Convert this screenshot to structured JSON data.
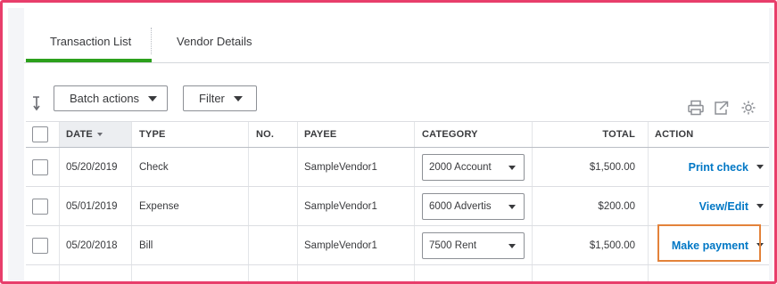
{
  "tabs": [
    {
      "label": "Transaction List",
      "active": true
    },
    {
      "label": "Vendor Details",
      "active": false
    }
  ],
  "toolbar": {
    "batch_actions_label": "Batch actions",
    "filter_label": "Filter"
  },
  "table": {
    "headers": {
      "date": "DATE",
      "type": "TYPE",
      "no": "NO.",
      "payee": "PAYEE",
      "category": "CATEGORY",
      "total": "TOTAL",
      "action": "ACTION"
    },
    "rows": [
      {
        "date": "05/20/2019",
        "type": "Check",
        "no": "",
        "payee": "SampleVendor1",
        "category": "2000 Account",
        "total": "$1,500.00",
        "action": "Print check"
      },
      {
        "date": "05/01/2019",
        "type": "Expense",
        "no": "",
        "payee": "SampleVendor1",
        "category": "6000 Advertis",
        "total": "$200.00",
        "action": "View/Edit"
      },
      {
        "date": "05/20/2018",
        "type": "Bill",
        "no": "",
        "payee": "SampleVendor1",
        "category": "7500 Rent",
        "total": "$1,500.00",
        "action": "Make payment"
      }
    ]
  },
  "colors": {
    "frame_border": "#e83e6b",
    "active_tab_underline": "#2ca01c",
    "link": "#0077c5",
    "highlight_box": "#e3823a"
  },
  "icons": [
    "sort-icon",
    "print-icon",
    "export-icon",
    "gear-icon"
  ]
}
